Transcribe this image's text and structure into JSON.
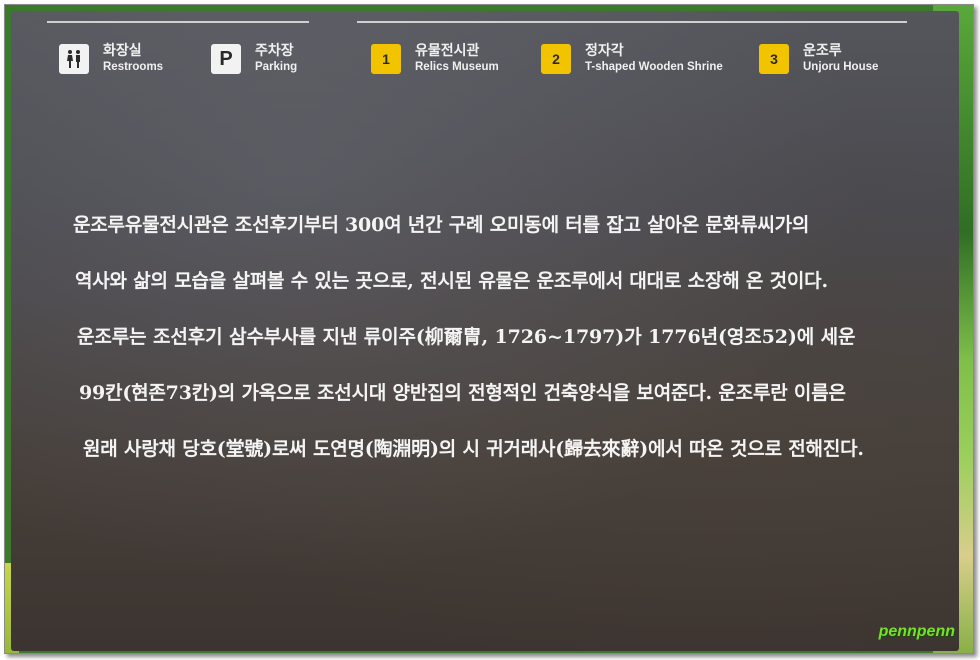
{
  "legend": [
    {
      "icon": "restroom-icon",
      "ko": "화장실",
      "en": "Restrooms"
    },
    {
      "icon": "parking-icon",
      "glyph": "P",
      "ko": "주차장",
      "en": "Parking"
    },
    {
      "icon": "number-1-icon",
      "glyph": "1",
      "ko": "유물전시관",
      "en": "Relics Museum"
    },
    {
      "icon": "number-2-icon",
      "glyph": "2",
      "ko": "정자각",
      "en": "T-shaped Wooden Shrine"
    },
    {
      "icon": "number-3-icon",
      "glyph": "3",
      "ko": "운조루",
      "en": "Unjoru House"
    }
  ],
  "body": {
    "lines": [
      "운조루유물전시관은 조선후기부터 300여 년간 구례 오미동에 터를 잡고 살아온 문화류씨가의",
      "역사와 삶의 모습을 살펴볼 수 있는 곳으로, 전시된 유물은 운조루에서 대대로 소장해 온 것이다.",
      "운조루는 조선후기 삼수부사를 지낸 류이주(柳爾冑, 1726~1797)가 1776년(영조52)에 세운",
      "99칸(현존73칸)의 가옥으로 조선시대 양반집의 전형적인 건축양식을 보여준다. 운조루란 이름은",
      "원래 사랑채 당호(堂號)로써 도연명(陶淵明)의 시 귀거래사(歸去來辭)에서 따온 것으로 전해진다."
    ]
  },
  "watermark": "pennpenn",
  "colors": {
    "board": "#4a4a50",
    "text": "#f4f4f4",
    "number_badge": "#f2c400",
    "watermark": "#7adf2a"
  }
}
